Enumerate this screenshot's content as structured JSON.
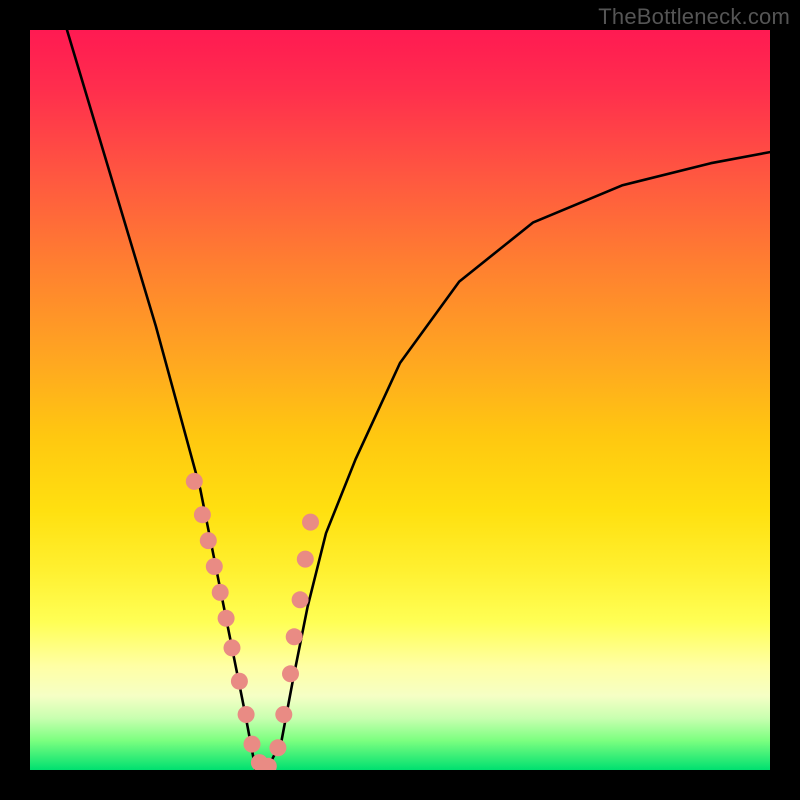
{
  "watermark": "TheBottleneck.com",
  "chart_data": {
    "type": "line",
    "title": "",
    "xlabel": "",
    "ylabel": "",
    "xlim": [
      0,
      1
    ],
    "ylim": [
      0,
      1
    ],
    "series": [
      {
        "name": "curve",
        "x": [
          0.05,
          0.08,
          0.11,
          0.14,
          0.17,
          0.2,
          0.23,
          0.25,
          0.27,
          0.29,
          0.305,
          0.32,
          0.34,
          0.355,
          0.375,
          0.4,
          0.44,
          0.5,
          0.58,
          0.68,
          0.8,
          0.92,
          1.0
        ],
        "y": [
          1.0,
          0.9,
          0.8,
          0.7,
          0.6,
          0.49,
          0.38,
          0.28,
          0.18,
          0.08,
          0.0,
          0.0,
          0.04,
          0.12,
          0.22,
          0.32,
          0.42,
          0.55,
          0.66,
          0.74,
          0.79,
          0.82,
          0.835
        ]
      }
    ],
    "markers": {
      "name": "dots",
      "color": "#e98b84",
      "x": [
        0.222,
        0.233,
        0.241,
        0.249,
        0.257,
        0.265,
        0.273,
        0.283,
        0.292,
        0.3,
        0.31,
        0.322,
        0.335,
        0.343,
        0.352,
        0.357,
        0.365,
        0.372,
        0.379
      ],
      "y": [
        0.39,
        0.345,
        0.31,
        0.275,
        0.24,
        0.205,
        0.165,
        0.12,
        0.075,
        0.035,
        0.01,
        0.005,
        0.03,
        0.075,
        0.13,
        0.18,
        0.23,
        0.285,
        0.335
      ]
    },
    "gradient_stops": [
      {
        "pos": 0.0,
        "color": "#ff1a52"
      },
      {
        "pos": 0.5,
        "color": "#ffc020"
      },
      {
        "pos": 0.82,
        "color": "#ffff60"
      },
      {
        "pos": 1.0,
        "color": "#00e070"
      }
    ]
  }
}
